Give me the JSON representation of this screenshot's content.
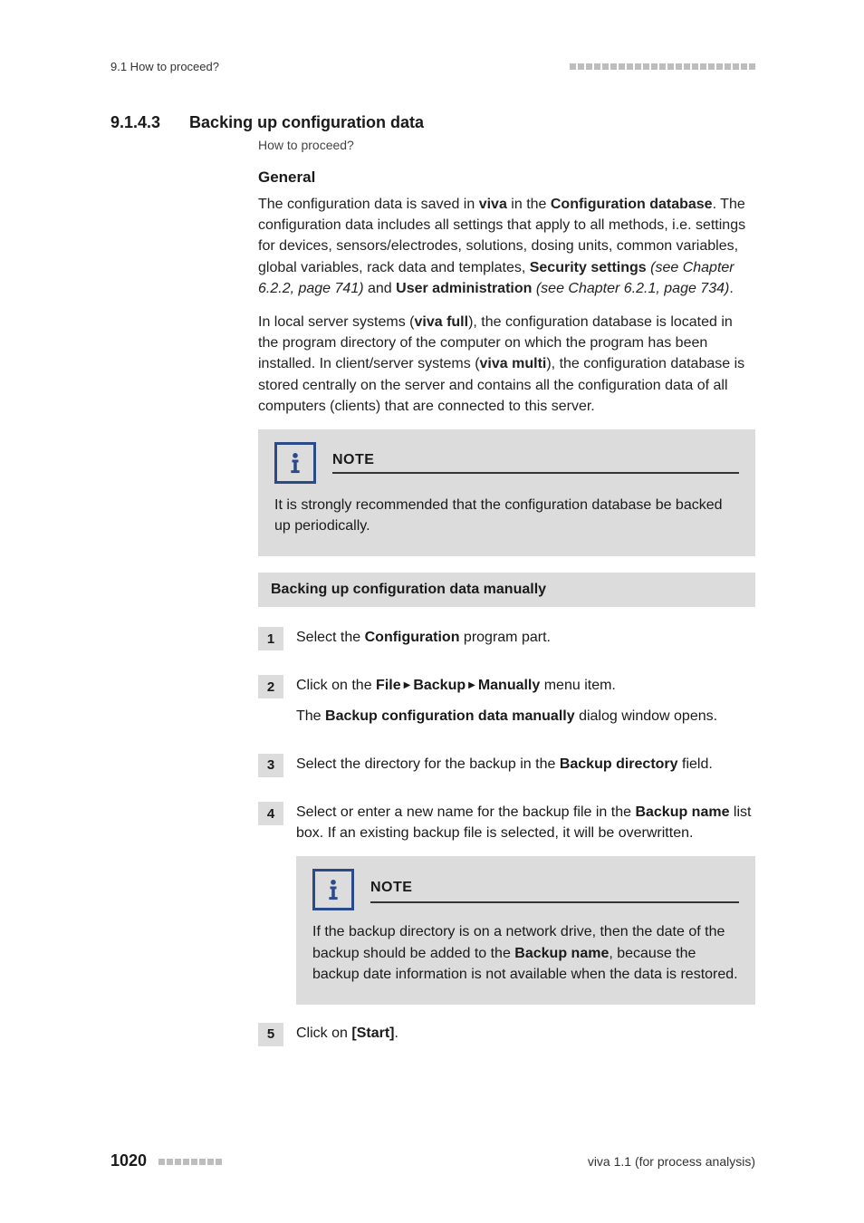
{
  "header": {
    "running": "9.1 How to proceed?"
  },
  "section": {
    "number": "9.1.4.3",
    "title": "Backing up configuration data",
    "breadcrumb": "How to proceed?"
  },
  "general": {
    "heading": "General",
    "p1_a": "The configuration data is saved in ",
    "p1_b": "viva",
    "p1_c": " in the ",
    "p1_d": "Configuration database",
    "p1_e": ". The configuration data includes all settings that apply to all methods, i.e. settings for devices, sensors/electrodes, solutions, dosing units, common variables, global variables, rack data and templates, ",
    "p1_f": "Security settings",
    "p1_g": " (see Chapter 6.2.2, page 741)",
    "p1_h": " and ",
    "p1_i": "User administration",
    "p1_j": " (see Chapter 6.2.1, page 734)",
    "p1_k": ".",
    "p2_a": "In local server systems (",
    "p2_b": "viva full",
    "p2_c": "), the configuration database is located in the program directory of the computer on which the program has been installed. In client/server systems (",
    "p2_d": "viva multi",
    "p2_e": "), the configuration database is stored centrally on the server and contains all the configuration data of all computers (clients) that are connected to this server."
  },
  "note1": {
    "title": "NOTE",
    "text": "It is strongly recommended that the configuration database be backed up periodically."
  },
  "procedure": {
    "heading": "Backing up configuration data manually",
    "s1_a": "Select the ",
    "s1_b": "Configuration",
    "s1_c": " program part.",
    "s2_a": "Click on the ",
    "s2_b": "File",
    "s2_c": "Backup",
    "s2_d": "Manually",
    "s2_e": " menu item.",
    "s2_f": "The ",
    "s2_g": "Backup configuration data manually",
    "s2_h": " dialog window opens.",
    "s3_a": "Select the directory for the backup in the ",
    "s3_b": "Backup directory",
    "s3_c": " field.",
    "s4_a": "Select or enter a new name for the backup file in the ",
    "s4_b": "Backup name",
    "s4_c": " list box. If an existing backup file is selected, it will be overwritten.",
    "s5_a": "Click on ",
    "s5_b": "[Start]",
    "s5_c": ".",
    "n1": "1",
    "n2": "2",
    "n3": "3",
    "n4": "4",
    "n5": "5"
  },
  "note2": {
    "title": "NOTE",
    "t1": "If the backup directory is on a network drive, then the date of the backup should be added to the ",
    "t2": "Backup name",
    "t3": ", because the backup date information is not available when the data is restored."
  },
  "footer": {
    "page": "1020",
    "right": "viva 1.1 (for process analysis)"
  }
}
